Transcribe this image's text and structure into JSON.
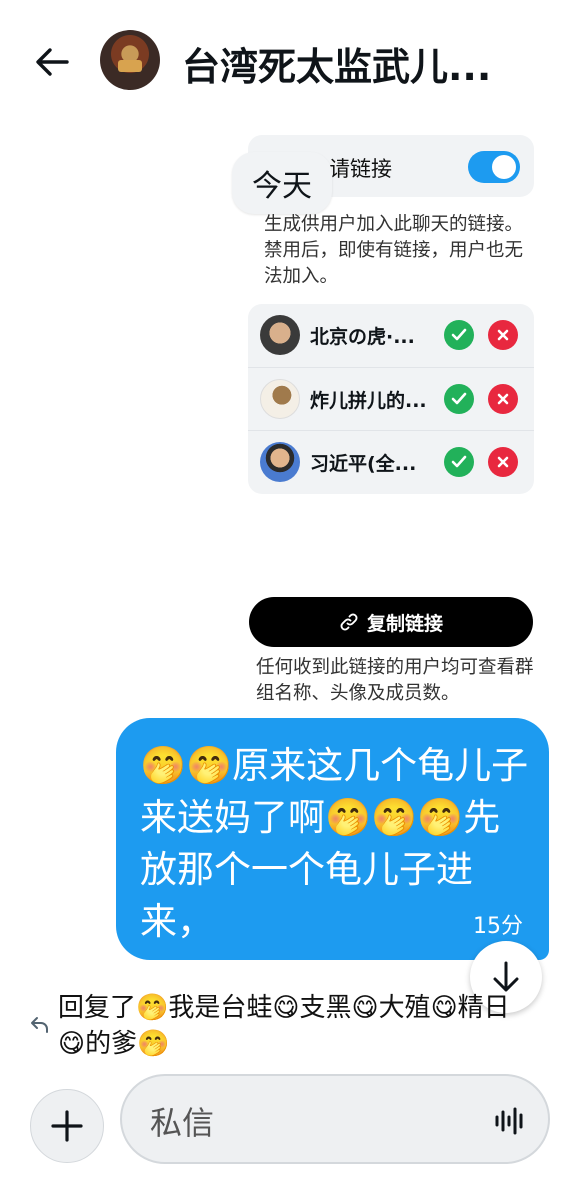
{
  "header": {
    "title": "台湾死太监武儿..."
  },
  "settings": {
    "invite_label": "群组邀请链接",
    "invite_enabled": true,
    "invite_desc": "生成供用户加入此聊天的链接。禁用后，即使有链接，用户也无法加入。"
  },
  "today_label": "今天",
  "members": [
    {
      "name": "北京の虎·..."
    },
    {
      "name": "炸儿拼儿的..."
    },
    {
      "name": "习近平(全..."
    }
  ],
  "copy": {
    "button_label": "复制链接",
    "desc": "任何收到此链接的用户均可查看群组名称、头像及成员数。"
  },
  "message": {
    "text": "🤭🤭原来这几个龟儿子来送妈了啊🤭🤭🤭先放那个一个龟儿子进来，",
    "time": "15分"
  },
  "reply": {
    "text": "回复了🤭我是台蛙😋支黑😋大殖😋精日😋的爹🤭"
  },
  "composer": {
    "placeholder": "私信"
  },
  "colors": {
    "accent": "#1d9bf0",
    "accept": "#22b15a",
    "reject": "#e8283f"
  }
}
